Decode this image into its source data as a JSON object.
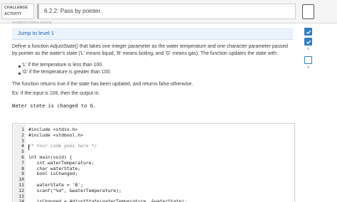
{
  "header": {
    "activity_label": "CHALLENGE\nACTIVITY",
    "title": "6.2.2: Pass by pointer."
  },
  "levels": [
    {
      "number": "1",
      "status": "completed"
    },
    {
      "number": "2",
      "status": "completed"
    },
    {
      "number": "3",
      "status": "incomplete"
    }
  ],
  "main": {
    "activity_tag": "INTERACTIONS activity",
    "jump_label": "Jump to level 1",
    "description_line1": "Define a function AdjustState() that takes one integer parameter as the water temperature and one character parameter passed",
    "description_line2": "by pointer as the water's state ('L' means liquid, 'B' means boiling, and 'G' means gas). The function updates the state with:",
    "bullets": [
      "'L' if the temperature is less than 100.",
      "'G' if the temperature is greater than 100."
    ],
    "return_text": "The function returns true if the state has been updated, and returns false otherwise.",
    "example_text": "Ex: If the input is 109, then the output is:",
    "example_output": "Water state is changed to G."
  },
  "code": {
    "lines": [
      {
        "num": "1",
        "text": "#include <stdio.h>"
      },
      {
        "num": "2",
        "text": "#include <stdbool.h>"
      },
      {
        "num": "3",
        "text": ""
      },
      {
        "num": "4",
        "text": "/* Your code goes here */"
      },
      {
        "num": "5",
        "text": ""
      },
      {
        "num": "6",
        "text": "int main(void) {"
      },
      {
        "num": "7",
        "text": "   int waterTemperature;"
      },
      {
        "num": "8",
        "text": "   char waterState;"
      },
      {
        "num": "9",
        "text": "   bool isChanged;"
      },
      {
        "num": "10",
        "text": ""
      },
      {
        "num": "11",
        "text": "   waterState = 'B';"
      },
      {
        "num": "12",
        "text": "   scanf(\"%d\", &waterTemperature);"
      },
      {
        "num": "13",
        "text": ""
      },
      {
        "num": "14",
        "text": "   isChanged = AdjustState(waterTemperature, &waterState);"
      }
    ]
  },
  "colors": {
    "accent": "#2f7fc1",
    "jump_bg": "#eaf2fb",
    "jump_text": "#1a63b0"
  },
  "icons": {
    "bookmark": "bookmark-icon",
    "check": "check-icon"
  }
}
